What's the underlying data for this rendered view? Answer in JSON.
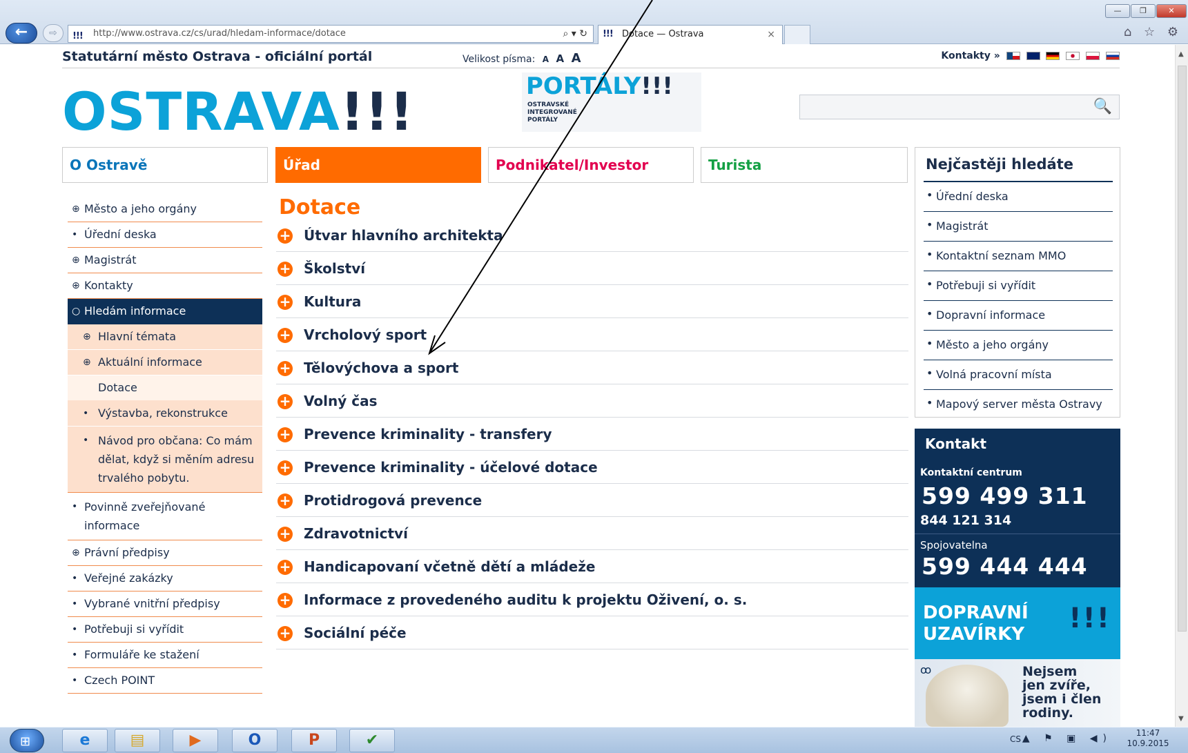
{
  "browser": {
    "back": "←",
    "forward": "⇨",
    "favicon": "!!!",
    "url": "http://www.ostrava.cz/cs/urad/hledam-informace/dotace",
    "url_controls": "⌕ ▾ ↻",
    "tab_title": "Dotace — Ostrava",
    "tab_close": "×",
    "toolbar_icons": "⌂ ☆ ⚙",
    "win_min": "—",
    "win_max": "❐",
    "win_close": "✕"
  },
  "header": {
    "site_title": "Statutární město Ostrava - oficiální portál",
    "font_size_label": "Velikost písma:",
    "font_sizes": [
      "A",
      "A",
      "A"
    ],
    "contacts": "Kontakty »",
    "logo_main": "OSTRAVA",
    "logo_ex": "!!!",
    "portaly_main": "PORTÁLY",
    "portaly_ex": "!!!",
    "portaly_line1": "OSTRAVSKÉ",
    "portaly_line2": "INTEGROVANÉ",
    "portaly_line3": "PORTÁLY",
    "search_icon": "🔍"
  },
  "nav": {
    "o_ostrave": "O Ostravě",
    "urad": "Úřad",
    "podnikatel": "Podnikatel/Investor",
    "turista": "Turista"
  },
  "left_menu": {
    "items": [
      {
        "icon": "⊕",
        "label": "Město a jeho orgány"
      },
      {
        "icon": "•",
        "label": "Úřední deska"
      },
      {
        "icon": "⊕",
        "label": "Magistrát"
      },
      {
        "icon": "⊕",
        "label": "Kontakty"
      },
      {
        "icon": "○",
        "label": "Hledám informace"
      },
      {
        "icon": "⊕",
        "label": "Hlavní témata"
      },
      {
        "icon": "⊕",
        "label": "Aktuální informace"
      },
      {
        "icon": "",
        "label": "Dotace"
      },
      {
        "icon": "•",
        "label": "Výstavba, rekonstrukce"
      },
      {
        "icon": "•",
        "label": "Návod pro občana: Co mám dělat, když si měním adresu trvalého pobytu."
      },
      {
        "icon": "•",
        "label": "Povinně zveřejňované informace"
      },
      {
        "icon": "⊕",
        "label": "Právní předpisy"
      },
      {
        "icon": "•",
        "label": "Veřejné zakázky"
      },
      {
        "icon": "•",
        "label": "Vybrané vnitřní předpisy"
      },
      {
        "icon": "•",
        "label": "Potřebuji si vyřídit"
      },
      {
        "icon": "•",
        "label": "Formuláře ke stažení"
      },
      {
        "icon": "•",
        "label": "Czech POINT"
      }
    ]
  },
  "main": {
    "title": "Dotace",
    "plus": "+",
    "categories": [
      "Útvar hlavního architekta",
      "Školství",
      "Kultura",
      "Vrcholový sport",
      "Tělovýchova a sport",
      "Volný čas",
      "Prevence kriminality - transfery",
      "Prevence kriminality - účelové dotace",
      "Protidrogová prevence",
      "Zdravotnictví",
      "Handicapovaní včetně dětí a mládeže",
      "Informace z provedeného auditu k projektu Oživení, o. s.",
      "Sociální péče"
    ]
  },
  "right": {
    "title": "Nejčastěji hledáte",
    "items": [
      "Úřední deska",
      "Magistrát",
      "Kontaktní seznam MMO",
      "Potřebuji si vyřídit",
      "Dopravní informace",
      "Město a jeho orgány",
      "Volná pracovní místa",
      "Mapový server města Ostravy"
    ]
  },
  "kontakt": {
    "title": "Kontakt",
    "centrum": "Kontaktní centrum",
    "number1": "599 499 311",
    "number2": "844 121 314",
    "spoj": "Spojovatelna",
    "number3": "599 444 444",
    "doprava_line1": "DOPRAVNÍ",
    "doprava_line2": "UZAVÍRKY",
    "doprava_ex": "!!!",
    "dog_line1": "Nejsem",
    "dog_line2": "jen zvíře,",
    "dog_line3": "jsem i člen",
    "dog_line4": "rodiny."
  },
  "taskbar": {
    "start": "⊞",
    "apps": [
      "e",
      "▤",
      "▶",
      "O",
      "P",
      "✔"
    ],
    "lang": "CS",
    "tray": "▲ ⚑ ▣ ◀)",
    "time": "11:47",
    "date": "10.9.2015"
  },
  "colors": {
    "accent_orange": "#ff6b00",
    "brand_blue": "#0ca2d8",
    "navy": "#0d3057"
  }
}
